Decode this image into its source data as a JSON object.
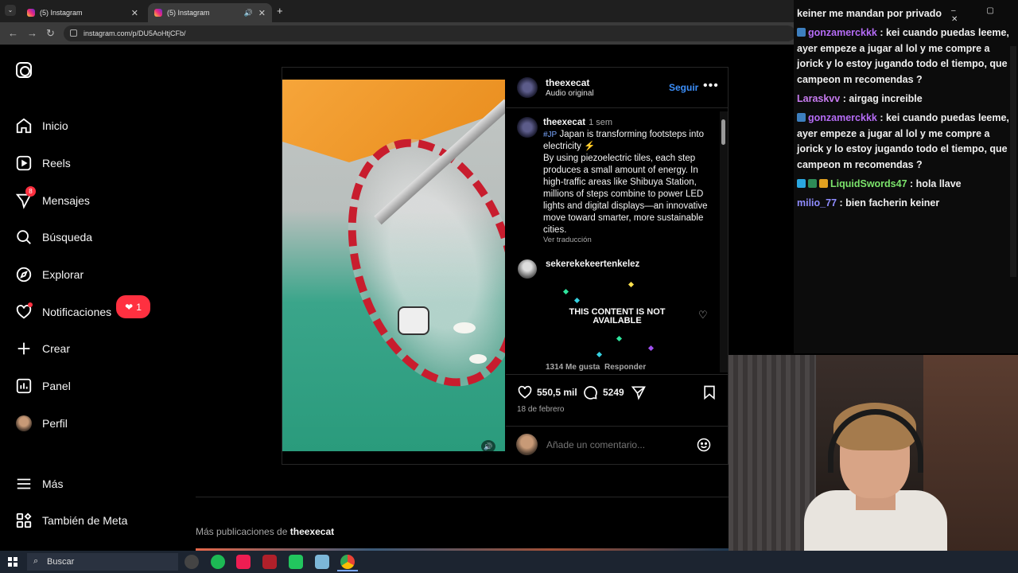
{
  "browser": {
    "tabs": [
      {
        "label": "(5) Instagram"
      },
      {
        "label": "(5) Instagram"
      }
    ],
    "url": "instagram.com/p/DU5AoHtjCFb/"
  },
  "sidebar": {
    "items": [
      {
        "label": "Inicio",
        "icon": "home-icon"
      },
      {
        "label": "Reels",
        "icon": "reels-icon"
      },
      {
        "label": "Mensajes",
        "icon": "messages-icon",
        "badge": "8"
      },
      {
        "label": "Búsqueda",
        "icon": "search-icon"
      },
      {
        "label": "Explorar",
        "icon": "explore-icon"
      },
      {
        "label": "Notificaciones",
        "icon": "heart-icon",
        "pill": "1"
      },
      {
        "label": "Crear",
        "icon": "plus-icon"
      },
      {
        "label": "Panel",
        "icon": "chart-icon"
      },
      {
        "label": "Perfil",
        "icon": "avatar"
      },
      {
        "label": "Más",
        "icon": "menu-icon"
      },
      {
        "label": "También de Meta",
        "icon": "meta-icon"
      }
    ]
  },
  "post": {
    "author": "theexecat",
    "audio": "Audio original",
    "follow_label": "Seguir",
    "caption": {
      "author": "theexecat",
      "time": "1 sem",
      "tag": "#JP",
      "text_1": "Japan is transforming footsteps into electricity ⚡",
      "text_2": "By using piezoelectric tiles, each step produces a small amount of energy. In high-traffic areas like Shibuya Station, millions of steps combine to power LED lights and digital displays—an innovative move toward smarter, more sustainable cities.",
      "translate": "Ver traducción"
    },
    "comment": {
      "user": "sekerekekeertenkelez",
      "gif_text": "THIS CONTENT IS NOT AVAILABLE",
      "likes": "1314 Me gusta",
      "reply": "Responder"
    },
    "likes": "550,5 mil",
    "comments": "5249",
    "date": "18 de febrero",
    "add_comment_placeholder": "Añade un comentario...",
    "more_posts_prefix": "Más publicaciones de",
    "more_posts_user": "theexecat"
  },
  "chat": {
    "lines": [
      {
        "user": "",
        "text": "keiner me mandan por privado",
        "color": "#f0f0f0"
      },
      {
        "user": "gonzamerckkk",
        "text": ": kei cuando puedas leeme, ayer empeze a jugar al lol y me compre a jorick y lo estoy jugando todo el tiempo, que campeon m recomendas ?",
        "color": "#b56cf5"
      },
      {
        "user": "Laraskvv",
        "text": ": airgag increible",
        "color": "#c77bf0"
      },
      {
        "user": "gonzamerckkk",
        "text": ": kei cuando puedas leeme, ayer empeze a jugar al lol y me compre a jorick y lo estoy jugando todo el tiempo, que campeon m recomendas ?",
        "color": "#b56cf5"
      },
      {
        "user": "LiquidSwords47",
        "text": ": hola llave",
        "color": "#7be36b"
      },
      {
        "user": "milio_77",
        "text": ": bien facherin keiner",
        "color": "#8f8cff"
      }
    ]
  },
  "taskbar": {
    "search_label": "Buscar"
  },
  "colors": {
    "accent": "#3c8ffa",
    "notification": "#ff3040"
  }
}
